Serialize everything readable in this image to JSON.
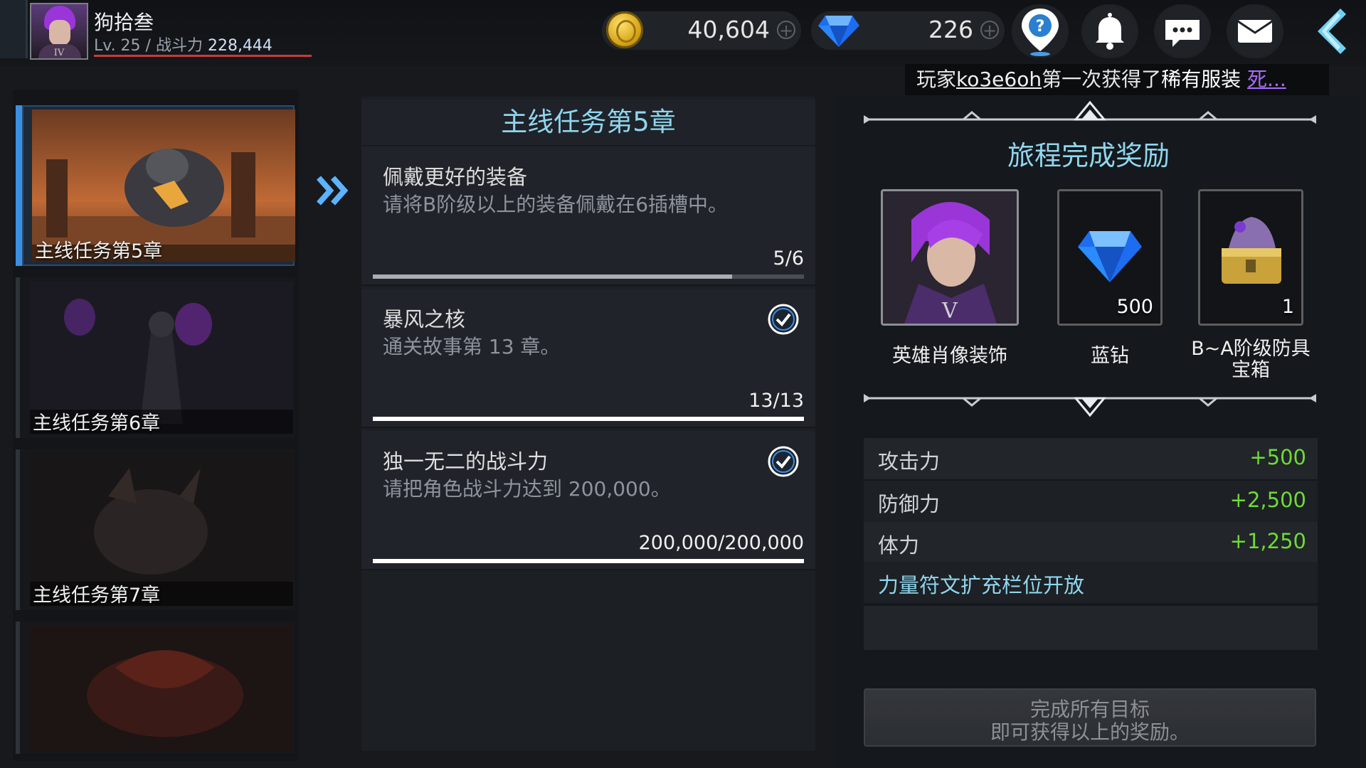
{
  "player": {
    "name": "狗拾叁",
    "tier": "IV",
    "level_text": "Lv. 25 / 战斗力",
    "power": "228,444"
  },
  "currency": {
    "gold": "40,604",
    "gems": "226"
  },
  "ticker": {
    "prefix": "玩家",
    "player": "ko3e6oh",
    "middle": "第一次获得了",
    "bold": "稀有服装",
    "item": "死..."
  },
  "chapters": [
    {
      "label": "主线任务第5章",
      "active": true
    },
    {
      "label": "主线任务第6章",
      "active": false
    },
    {
      "label": "主线任务第7章",
      "active": false
    },
    {
      "label": "",
      "active": false
    }
  ],
  "quest": {
    "title": "主线任务第5章",
    "objectives": [
      {
        "title": "佩戴更好的装备",
        "desc": "请将B阶级以上的装备佩戴在6插槽中。",
        "count": "5/6",
        "progress": 0.833,
        "done": false
      },
      {
        "title": "暴风之核",
        "desc": "通关故事第 13 章。",
        "count": "13/13",
        "progress": 1.0,
        "done": true
      },
      {
        "title": "独一无二的战斗力",
        "desc": "请把角色战斗力达到 200,000。",
        "count": "200,000/200,000",
        "progress": 1.0,
        "done": true
      }
    ]
  },
  "rewards": {
    "title": "旅程完成奖励",
    "items": [
      {
        "label": "英雄肖像装饰",
        "qty": "",
        "tier": "V"
      },
      {
        "label": "蓝钻",
        "qty": "500"
      },
      {
        "label": "B~A阶级防具宝箱",
        "qty": "1"
      }
    ],
    "stats": [
      {
        "name": "攻击力",
        "value": "+500"
      },
      {
        "name": "防御力",
        "value": "+2,500"
      },
      {
        "name": "体力",
        "value": "+1,250"
      }
    ],
    "unlock": "力量符文扩充栏位开放",
    "claim_line1": "完成所有目标",
    "claim_line2": "即可获得以上的奖励。"
  },
  "colors": {
    "accent": "#8fd6ee",
    "active_blue": "#3b8fe3",
    "stat_green": "#6ddb36",
    "rare_purple": "#a86cff"
  }
}
